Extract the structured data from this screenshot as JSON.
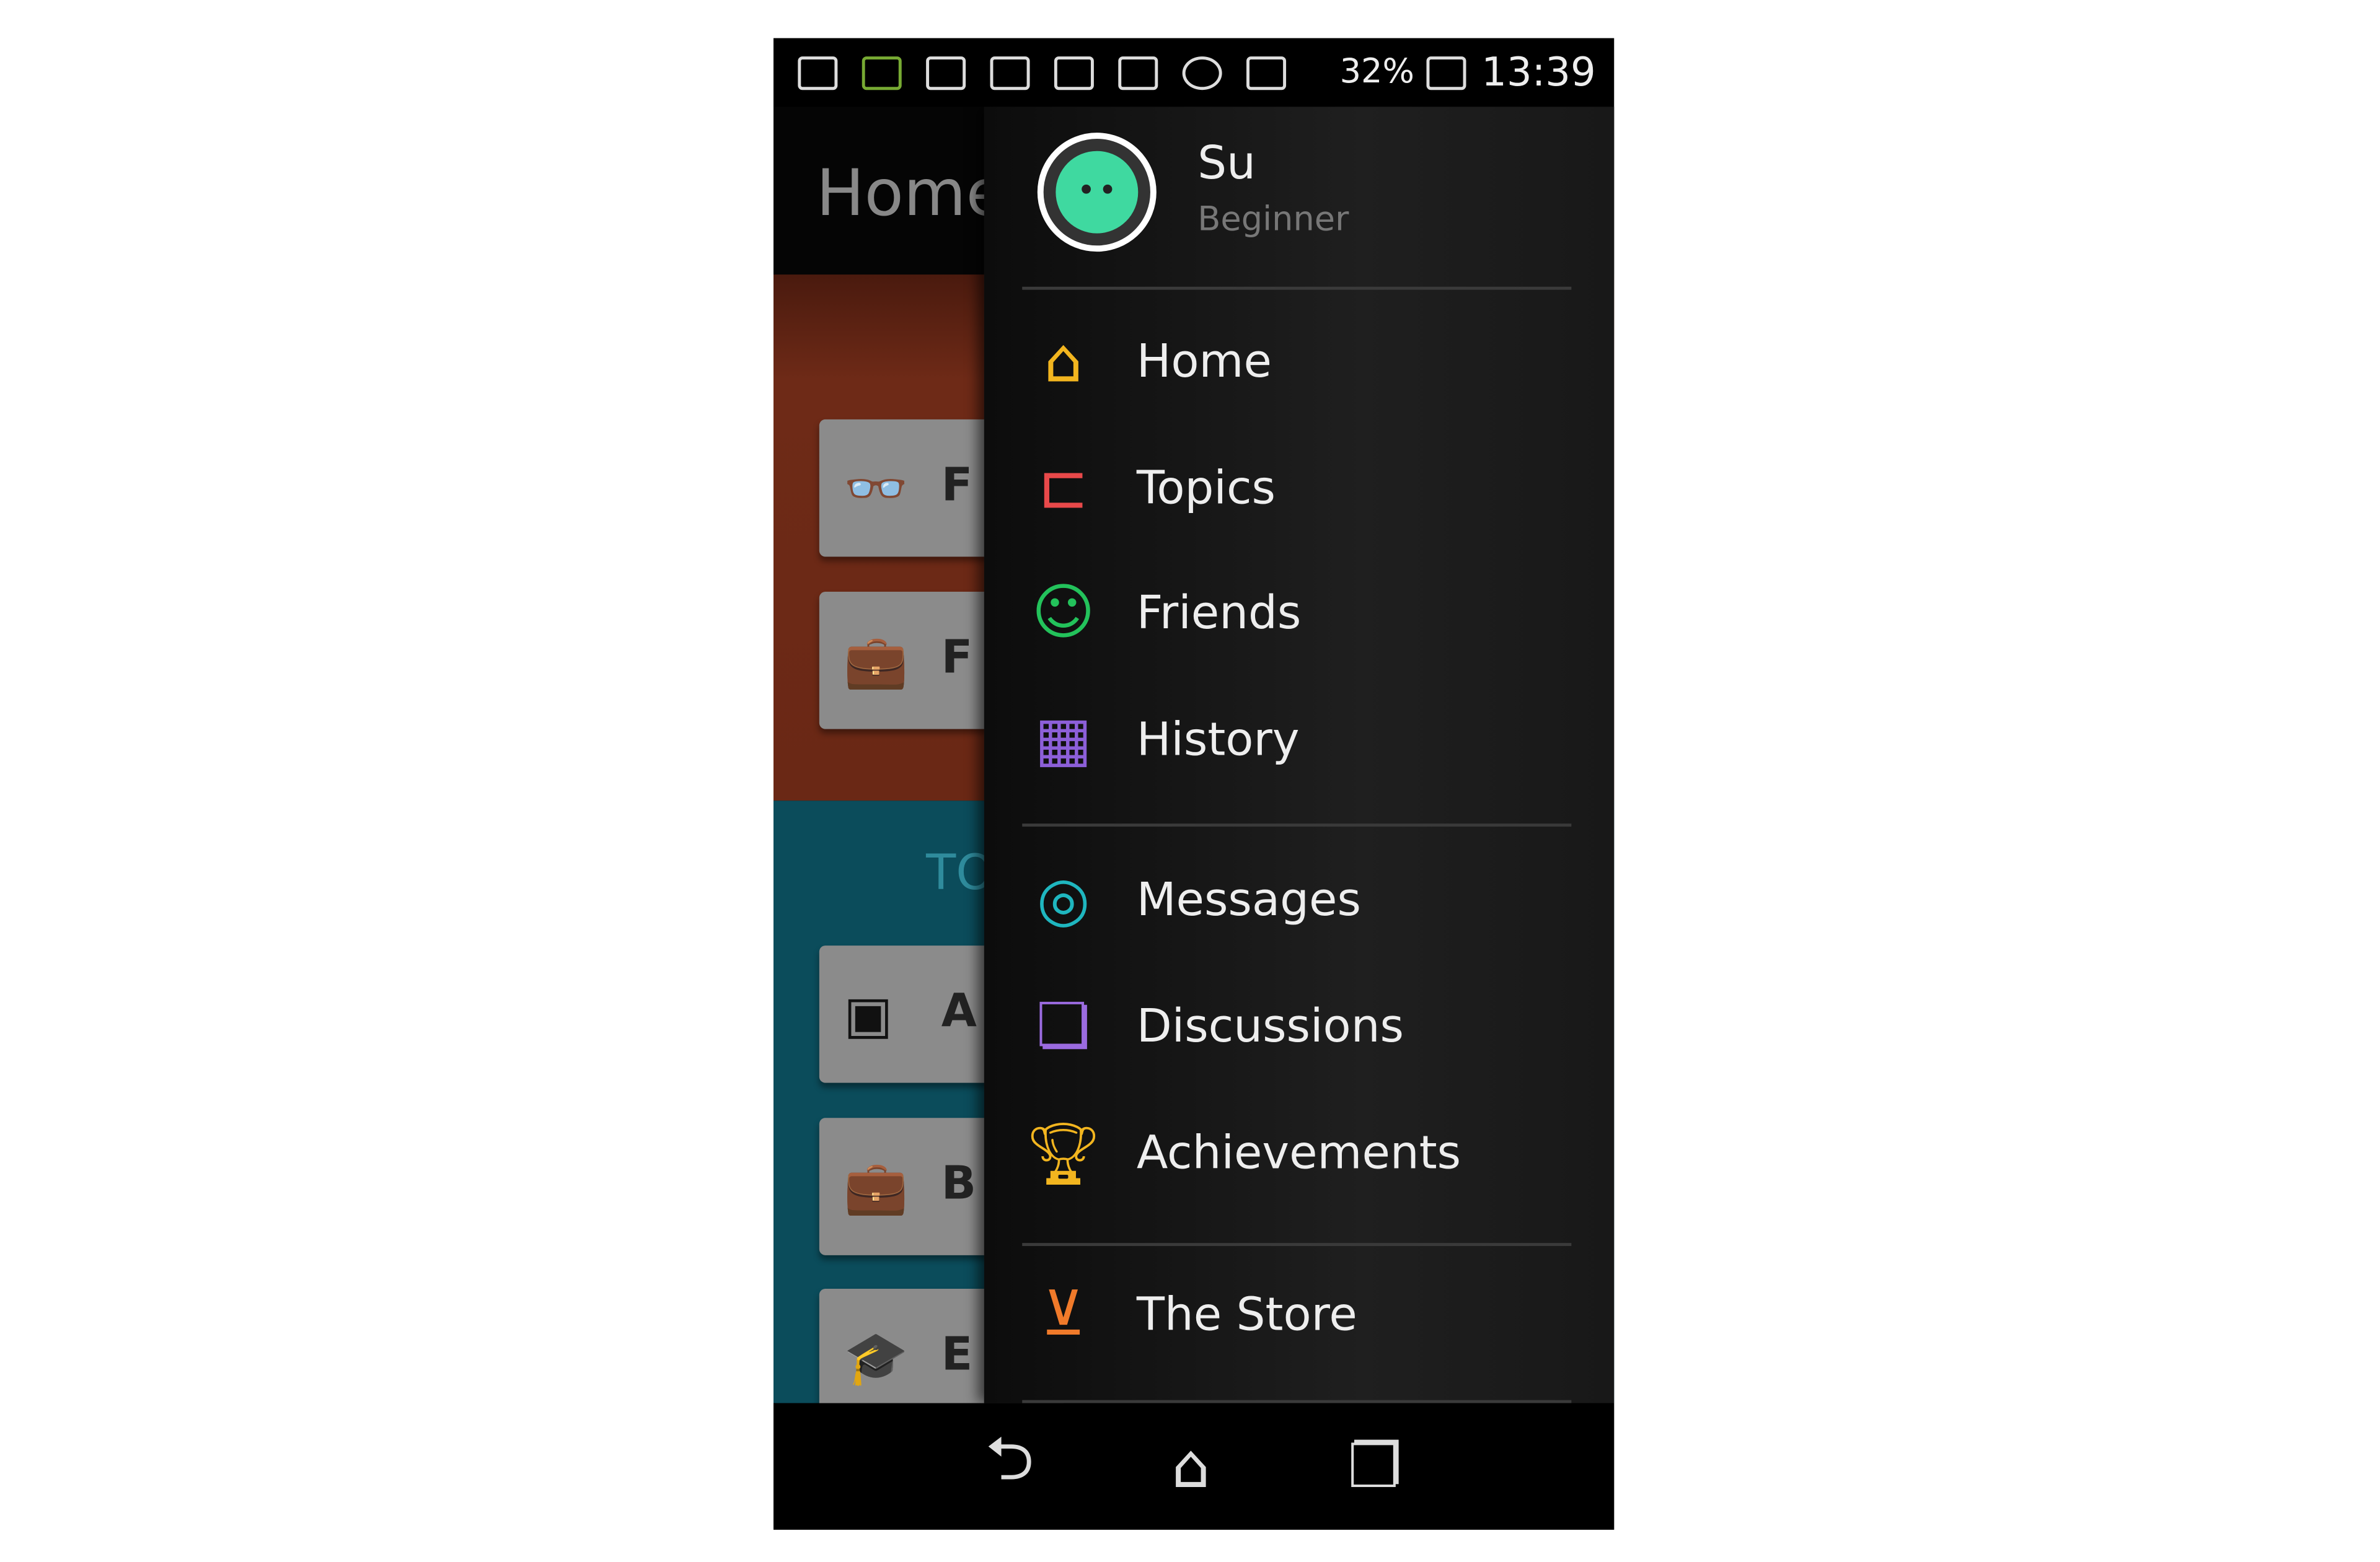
{
  "status_bar": {
    "battery": "32%",
    "time": "13:39",
    "icons": [
      "usb-icon",
      "notification-icon",
      "image-icon",
      "nfc-icon",
      "shield-icon",
      "bluetooth-off-icon",
      "alarm-icon",
      "wifi-icon",
      "signal-icon",
      "battery-icon"
    ]
  },
  "background": {
    "title": "Home",
    "section_title": "TO",
    "cards": [
      {
        "icon": "glasses-icon",
        "label": "F"
      },
      {
        "icon": "briefcase-icon",
        "label": "F"
      },
      {
        "icon": "frame-icon",
        "label": "A"
      },
      {
        "icon": "briefcase-icon",
        "label": "B"
      },
      {
        "icon": "graduation-cap-icon",
        "label": "E"
      }
    ]
  },
  "drawer": {
    "profile": {
      "name": "Su",
      "level": "Beginner"
    },
    "items": [
      {
        "label": "Home",
        "icon": "home-icon",
        "color": "#f2b51f"
      },
      {
        "label": "Topics",
        "icon": "topics-tree-icon",
        "color": "#e8494a"
      },
      {
        "label": "Friends",
        "icon": "smiley-icon",
        "color": "#23c25b"
      },
      {
        "label": "History",
        "icon": "calendar-icon",
        "color": "#8c5fd8"
      },
      {
        "label": "Messages",
        "icon": "hi-bubble-icon",
        "color": "#1fb6bf"
      },
      {
        "label": "Discussions",
        "icon": "chat-bubbles-icon",
        "color": "#9b6be0"
      },
      {
        "label": "Achievements",
        "icon": "trophy-icon",
        "color": "#f2b51f"
      },
      {
        "label": "The Store",
        "icon": "mortar-pestle-icon",
        "color": "#f07a2a"
      }
    ]
  },
  "navbar": {
    "buttons": [
      "back-icon",
      "home-icon",
      "recent-apps-icon"
    ]
  }
}
